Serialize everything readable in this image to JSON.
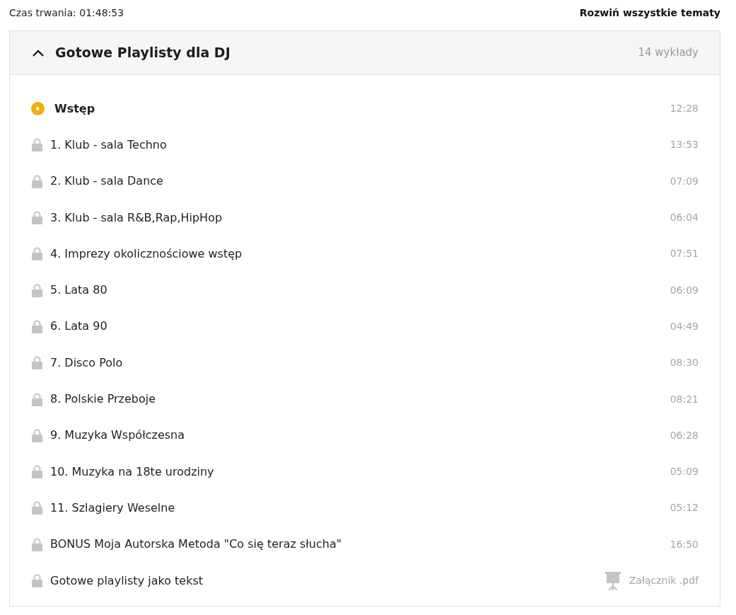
{
  "duration_label": "Czas trwania: 01:48:53",
  "expand_all": "Rozwiń wszystkie tematy",
  "section": {
    "title": "Gotowe Playlisty dla DJ",
    "expanded": true,
    "count": "14 wykłady",
    "lectures": [
      {
        "title": "Wstęp",
        "locked": false,
        "duration": "12:28"
      },
      {
        "title": "1. Klub - sala Techno",
        "locked": true,
        "duration": "13:53"
      },
      {
        "title": "2. Klub - sala Dance",
        "locked": true,
        "duration": "07:09"
      },
      {
        "title": "3. Klub - sala R&B,Rap,HipHop",
        "locked": true,
        "duration": "06:04"
      },
      {
        "title": "4. Imprezy okolicznościowe wstęp",
        "locked": true,
        "duration": "07:51"
      },
      {
        "title": "5. Lata 80",
        "locked": true,
        "duration": "06:09"
      },
      {
        "title": "6. Lata 90",
        "locked": true,
        "duration": "04:49"
      },
      {
        "title": "7. Disco Polo",
        "locked": true,
        "duration": "08:30"
      },
      {
        "title": "8. Polskie Przeboje",
        "locked": true,
        "duration": "08:21"
      },
      {
        "title": "9. Muzyka Współczesna",
        "locked": true,
        "duration": "06:28"
      },
      {
        "title": "10. Muzyka na 18te urodziny",
        "locked": true,
        "duration": "05:09"
      },
      {
        "title": "11. Szlagiery Weselne",
        "locked": true,
        "duration": "05:12"
      },
      {
        "title": "BONUS Moja Autorska Metoda \"Co się teraz słucha\"",
        "locked": true,
        "duration": "16:50"
      },
      {
        "title": "Gotowe playlisty jako tekst",
        "locked": true,
        "attachment": "Załącznik .pdf"
      }
    ]
  }
}
